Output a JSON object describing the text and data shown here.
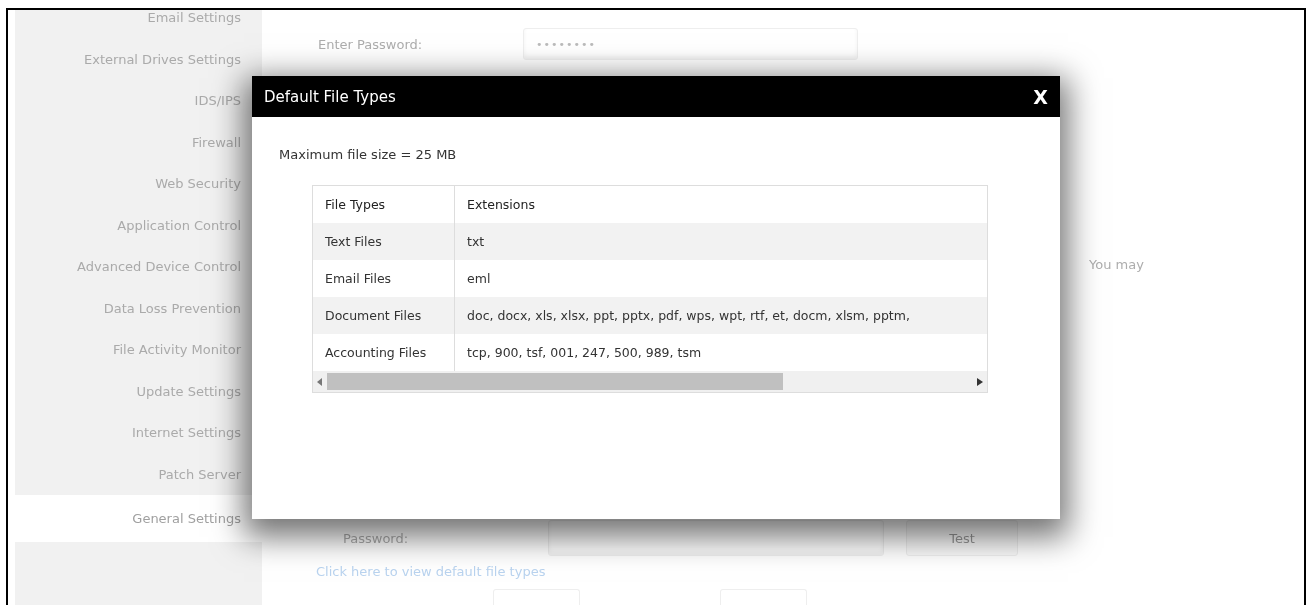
{
  "sidebar": {
    "items": [
      {
        "label": "Email Settings",
        "selected": false
      },
      {
        "label": "External Drives Settings",
        "selected": false
      },
      {
        "label": "IDS/IPS",
        "selected": false
      },
      {
        "label": "Firewall",
        "selected": false
      },
      {
        "label": "Web Security",
        "selected": false
      },
      {
        "label": "Application Control",
        "selected": false
      },
      {
        "label": "Advanced Device Control",
        "selected": false
      },
      {
        "label": "Data Loss Prevention",
        "selected": false
      },
      {
        "label": "File Activity Monitor",
        "selected": false
      },
      {
        "label": "Update Settings",
        "selected": false
      },
      {
        "label": "Internet Settings",
        "selected": false
      },
      {
        "label": "Patch Server",
        "selected": false
      },
      {
        "label": "General Settings",
        "selected": true
      }
    ]
  },
  "background": {
    "enter_password_label": "Enter Password:",
    "enter_password_value": "••••••••",
    "side_text": "You may",
    "password_label": "Password:",
    "test_button": "Test",
    "default_types_link": "Click here to view default file types"
  },
  "dialog": {
    "title": "Default File Types",
    "close": "X",
    "max_size": "Maximum file size = 25 MB",
    "table": {
      "columns": [
        "File Types",
        "Extensions"
      ],
      "rows": [
        [
          "Text Files",
          "txt"
        ],
        [
          "Email Files",
          "eml"
        ],
        [
          "Document Files",
          "doc, docx, xls, xlsx, ppt, pptx, pdf, wps, wpt, rtf, et, docm, xlsm, pptm,"
        ],
        [
          "Accounting Files",
          "tcp, 900, tsf, 001, 247, 500, 989, tsm"
        ]
      ]
    }
  }
}
